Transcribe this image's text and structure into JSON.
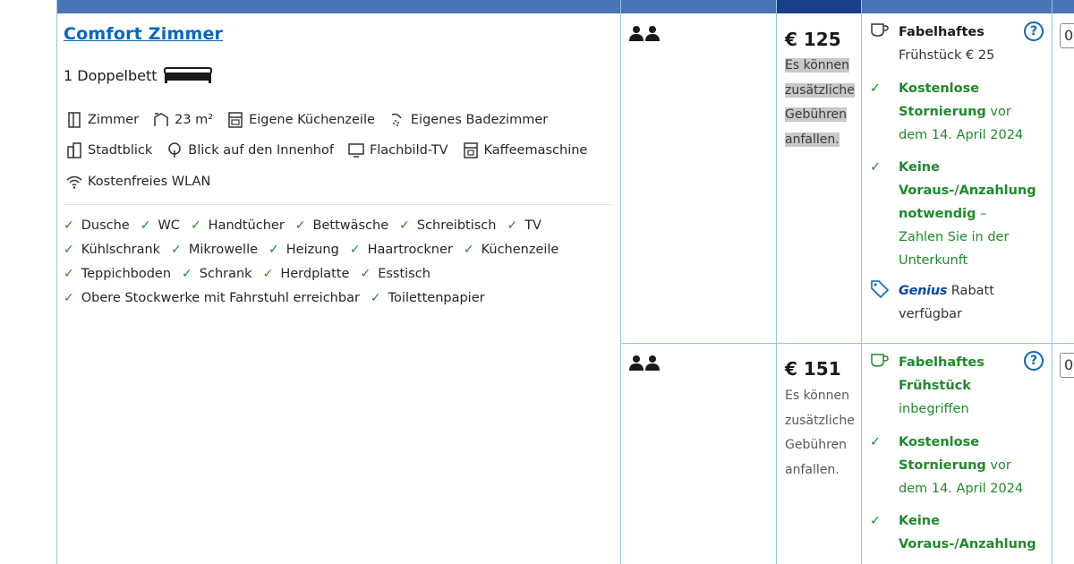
{
  "room": {
    "title": "Comfort Zimmer",
    "bed": "1 Doppelbett",
    "facilities_row1": [
      {
        "label": "Zimmer",
        "icon": "door-icon"
      },
      {
        "label": "23 m²",
        "icon": "room-size-icon"
      },
      {
        "label": "Eigene Küchenzeile",
        "icon": "kitchenette-icon"
      },
      {
        "label": "Eigenes Badezimmer",
        "icon": "shower-icon"
      }
    ],
    "facilities_row2": [
      {
        "label": "Stadtblick",
        "icon": "city-view-icon"
      },
      {
        "label": "Blick auf den Innenhof",
        "icon": "tree-icon"
      },
      {
        "label": "Flachbild-TV",
        "icon": "tv-icon"
      },
      {
        "label": "Kaffeemaschine",
        "icon": "coffee-machine-icon"
      }
    ],
    "facilities_row3": [
      {
        "label": "Kostenfreies WLAN",
        "icon": "wifi-icon"
      }
    ],
    "amenities_rows": [
      [
        "Dusche",
        "WC",
        "Handtücher",
        "Bettwäsche",
        "Schreibtisch",
        "TV"
      ],
      [
        "Kühlschrank",
        "Mikrowelle",
        "Heizung",
        "Haartrockner",
        "Küchenzeile"
      ],
      [
        "Teppichboden",
        "Schrank",
        "Herdplatte",
        "Esstisch"
      ],
      [
        "Obere Stockwerke mit Fahrstuhl erreichbar",
        "Toilettenpapier"
      ]
    ]
  },
  "options": [
    {
      "price": "€ 125",
      "fee_lines": [
        "Es können",
        "zusätzliche",
        "Gebühren",
        "anfallen."
      ],
      "breakfast_bold": "Fabelhaftes",
      "breakfast_rest": "Frühstück € 25",
      "cancel_bold1": "Kostenlose",
      "cancel_bold2": "Stornierung",
      "cancel_rest1": " vor",
      "cancel_rest2": "dem 14. April 2024",
      "prepay_bold1": "Keine",
      "prepay_bold2": "Voraus-/Anzahlung",
      "prepay_bold3": "notwendig",
      "prepay_rest1": " –",
      "prepay_rest2": "Zahlen Sie in der",
      "prepay_rest3": "Unterkunft",
      "genius_label": "Genius",
      "genius_rest1": " Rabatt",
      "genius_rest2": "verfügbar",
      "qty": "0"
    },
    {
      "price": "€ 151",
      "fee_lines": [
        "Es können",
        "zusätzliche",
        "Gebühren",
        "anfallen."
      ],
      "breakfast_bold1": "Fabelhaftes",
      "breakfast_bold2": "Frühstück",
      "breakfast_rest": "inbegriffen",
      "cancel_bold1": "Kostenlose",
      "cancel_bold2": "Stornierung",
      "cancel_rest1": " vor",
      "cancel_rest2": "dem 14. April 2024",
      "prepay_bold1": "Keine",
      "prepay_bold2": "Voraus-/Anzahlung",
      "qty": "0"
    }
  ],
  "help_label": "?",
  "check_glyph": "✓"
}
